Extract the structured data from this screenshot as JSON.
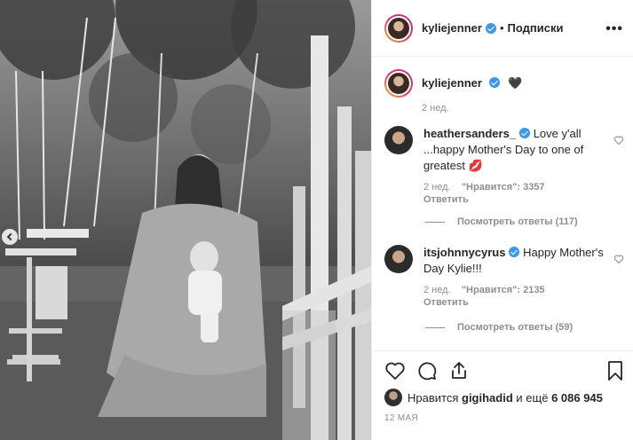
{
  "post": {
    "author": "kyliejenner",
    "dot": "•",
    "follow_label": "Подписки",
    "more_label": "•••",
    "caption_emoji": "🖤",
    "caption_time": "2 нед."
  },
  "comments": [
    {
      "username": "heathersanders_",
      "text": "Love y'all ...happy Mother's Day to one of greatest 💋",
      "time": "2 нед.",
      "likes": "\"Нравится\": 3357",
      "reply_label": "Ответить",
      "view_replies": "Посмотреть ответы (117)"
    },
    {
      "username": "itsjohnnycyrus",
      "text": "Happy Mother's Day Kylie!!!",
      "time": "2 нед.",
      "likes": "\"Нравится\": 2135",
      "reply_label": "Ответить",
      "view_replies": "Посмотреть ответы (59)"
    }
  ],
  "footer": {
    "likes_prefix": "Нравится",
    "liked_by": "gigihadid",
    "likes_suffix": "и ещё",
    "likes_count": "6 086 945",
    "date": "12 МАЯ"
  },
  "icons": {
    "like": "heart-outline-icon",
    "comment": "speech-bubble-icon",
    "share": "share-icon",
    "save": "bookmark-icon",
    "verified": "verified-badge-icon"
  }
}
